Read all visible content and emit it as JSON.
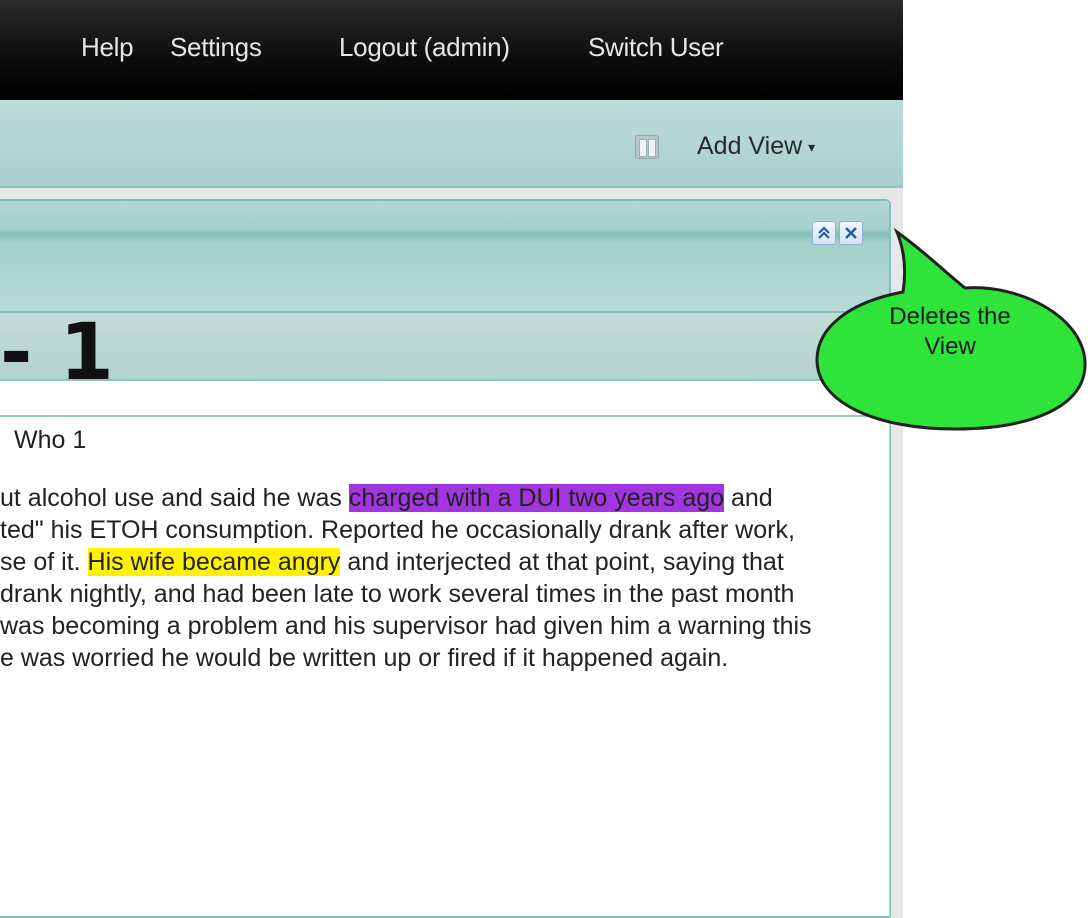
{
  "nav": {
    "help": "Help",
    "settings": "Settings",
    "logout": "Logout (admin)",
    "switch_user": "Switch User"
  },
  "toolbar": {
    "columns_icon": "columns-icon",
    "add_view": "Add View",
    "add_view_caret": "▾"
  },
  "panel": {
    "collapse_glyph": "⌃",
    "close_glyph": "✕"
  },
  "document": {
    "title": "- 1",
    "subtitle": "Who 1",
    "lines": [
      {
        "before": "ut alcohol use and said he was ",
        "highlight": "charged with a DUI two years ago",
        "after": " and",
        "color": "purple"
      },
      {
        "before": "ted\" his ETOH consumption. Reported he occasionally drank after work,",
        "highlight": "",
        "after": "",
        "color": ""
      },
      {
        "before": "se of it. ",
        "highlight": "His wife became angry",
        "after": " and interjected at that point, saying that",
        "color": "yellow"
      },
      {
        "before": "drank nightly, and had been late to work several times in the past month",
        "highlight": "",
        "after": "",
        "color": ""
      },
      {
        "before": "was becoming a problem and his supervisor had given him a warning this",
        "highlight": "",
        "after": "",
        "color": ""
      },
      {
        "before": "e was worried he would be written up or fired if it happened again.",
        "highlight": "",
        "after": "",
        "color": ""
      }
    ]
  },
  "callout": {
    "text_line1": "Deletes the",
    "text_line2": "View",
    "fill": "#2ee33a"
  },
  "colors": {
    "highlight_purple": "#a135e0",
    "highlight_yellow": "#fff200",
    "panel_teal": "#a9d0cb"
  }
}
